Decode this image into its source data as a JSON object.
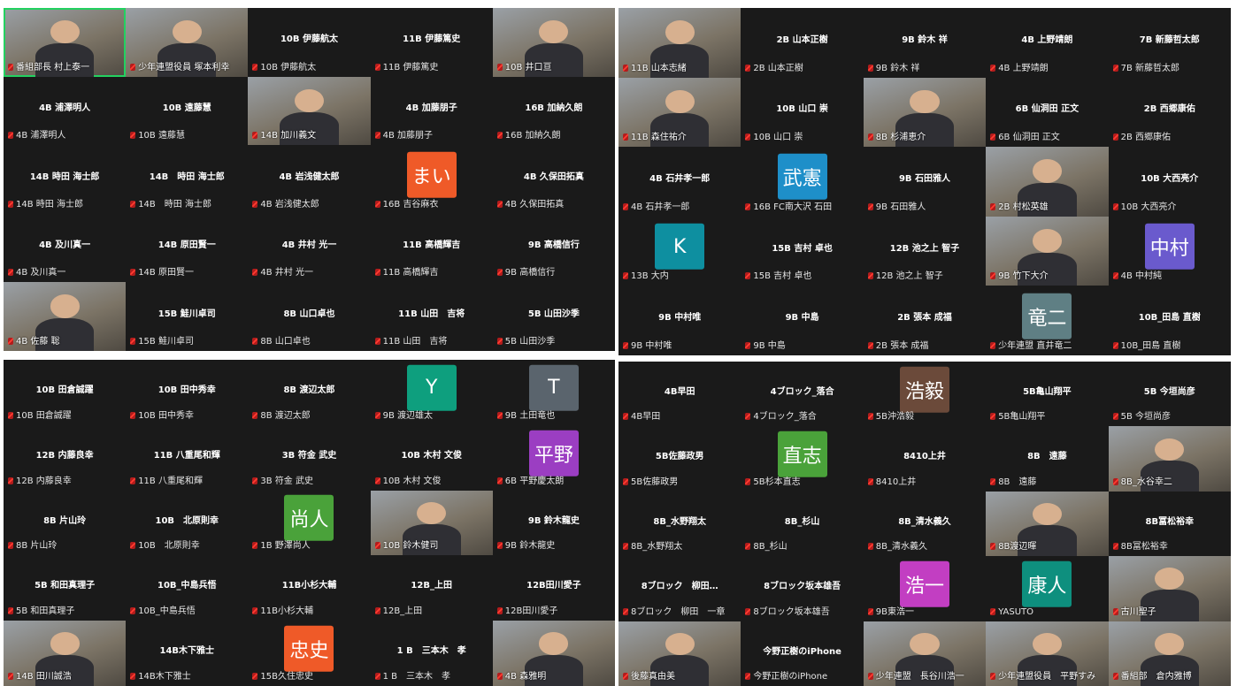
{
  "colors": {
    "bg": "#1a1a1a",
    "speaker_border": "#23d160",
    "mic_off": "#ff3b30"
  },
  "quadrants": [
    {
      "tiles": [
        {
          "type": "video",
          "label": "番組部長 村上泰一",
          "speaker": true
        },
        {
          "type": "video",
          "label": "少年連盟役員 塚本利幸"
        },
        {
          "type": "name",
          "center": "10B 伊藤航太",
          "label": "10B 伊藤航太"
        },
        {
          "type": "name",
          "center": "11B 伊藤篤史",
          "label": "11B 伊藤篤史"
        },
        {
          "type": "video",
          "label": "10B 井口亘"
        },
        {
          "type": "name",
          "center": "4B 浦澤明人",
          "label": "4B 浦澤明人"
        },
        {
          "type": "name",
          "center": "10B 遠藤慧",
          "label": "10B 遠藤慧"
        },
        {
          "type": "video",
          "label": "14B 加川義文"
        },
        {
          "type": "name",
          "center": "4B 加藤朋子",
          "label": "4B 加藤朋子"
        },
        {
          "type": "name",
          "center": "16B 加納久朗",
          "label": "16B 加納久朗"
        },
        {
          "type": "name",
          "center": "14B 時田 海士郎",
          "label": "14B 時田 海士郎"
        },
        {
          "type": "name",
          "center": "14B　時田 海士郎",
          "label": "14B　時田 海士郎"
        },
        {
          "type": "name",
          "center": "4B 岩浅健太郎",
          "label": "4B 岩浅健太郎"
        },
        {
          "type": "avatar",
          "avatar": "まい",
          "color": "#ef5a28",
          "label": "16B 吉谷麻衣"
        },
        {
          "type": "name",
          "center": "4B 久保田拓真",
          "label": "4B 久保田拓真"
        },
        {
          "type": "name",
          "center": "4B 及川真一",
          "label": "4B 及川真一"
        },
        {
          "type": "name",
          "center": "14B 原田賢一",
          "label": "14B 原田賢一"
        },
        {
          "type": "name",
          "center": "4B 井村 光一",
          "label": "4B 井村 光一"
        },
        {
          "type": "name",
          "center": "11B 高橋輝吉",
          "label": "11B 高橋輝吉"
        },
        {
          "type": "name",
          "center": "9B 高橋信行",
          "label": "9B 高橋信行"
        },
        {
          "type": "video",
          "label": "4B 佐藤 聡"
        },
        {
          "type": "name",
          "center": "15B 鮭川卓司",
          "label": "15B 鮭川卓司"
        },
        {
          "type": "name",
          "center": "8B 山口卓也",
          "label": "8B 山口卓也"
        },
        {
          "type": "name",
          "center": "11B 山田　吉将",
          "label": "11B 山田　吉将"
        },
        {
          "type": "name",
          "center": "5B 山田沙季",
          "label": "5B 山田沙季"
        }
      ]
    },
    {
      "tiles": [
        {
          "type": "video",
          "label": "11B 山本志緒"
        },
        {
          "type": "name",
          "center": "2B 山本正樹",
          "label": "2B 山本正樹"
        },
        {
          "type": "name",
          "center": "9B 鈴木 祥",
          "label": "9B 鈴木 祥"
        },
        {
          "type": "name",
          "center": "4B 上野靖朗",
          "label": "4B 上野靖朗"
        },
        {
          "type": "name",
          "center": "7B 新藤哲太郎",
          "label": "7B 新藤哲太郎"
        },
        {
          "type": "video",
          "label": "11B 森住祐介"
        },
        {
          "type": "name",
          "center": "10B 山口 崇",
          "label": "10B 山口 崇"
        },
        {
          "type": "video",
          "label": "8B 杉浦恵介"
        },
        {
          "type": "name",
          "center": "6B 仙洞田 正文",
          "label": "6B 仙洞田 正文"
        },
        {
          "type": "name",
          "center": "2B 西郷康佑",
          "label": "2B 西郷康佑"
        },
        {
          "type": "name",
          "center": "4B 石井孝一郎",
          "label": "4B 石井孝一郎"
        },
        {
          "type": "avatar",
          "avatar": "武憲",
          "color": "#1e8fc9",
          "label": "16B FC南大沢 石田"
        },
        {
          "type": "name",
          "center": "9B 石田雅人",
          "label": "9B 石田雅人"
        },
        {
          "type": "video",
          "label": "2B 村松英雄"
        },
        {
          "type": "name",
          "center": "10B 大西亮介",
          "label": "10B 大西亮介"
        },
        {
          "type": "avatar",
          "avatar": "K",
          "color": "#0e8fa0",
          "label": "13B 大内"
        },
        {
          "type": "name",
          "center": "15B 吉村 卓也",
          "label": "15B 吉村 卓也"
        },
        {
          "type": "name",
          "center": "12B 池之上 智子",
          "label": "12B 池之上 智子"
        },
        {
          "type": "video",
          "label": "9B 竹下大介"
        },
        {
          "type": "avatar",
          "avatar": "中村",
          "color": "#6a5acd",
          "label": "4B 中村純"
        },
        {
          "type": "name",
          "center": "9B 中村唯",
          "label": "9B 中村唯"
        },
        {
          "type": "name",
          "center": "9B 中島",
          "label": "9B 中島"
        },
        {
          "type": "name",
          "center": "2B 張本 成福",
          "label": "2B 張本 成福"
        },
        {
          "type": "avatar",
          "avatar": "竜二",
          "color": "#5f7f84",
          "label": "少年連盟 直井竜二"
        },
        {
          "type": "name",
          "center": "10B_田島 直樹",
          "label": "10B_田島 直樹"
        }
      ]
    },
    {
      "tiles": [
        {
          "type": "name",
          "center": "10B 田倉誠躍",
          "label": "10B 田倉誠躍"
        },
        {
          "type": "name",
          "center": "10B 田中秀幸",
          "label": "10B 田中秀幸"
        },
        {
          "type": "name",
          "center": "8B 渡辺太郎",
          "label": "8B 渡辺太郎"
        },
        {
          "type": "avatar",
          "avatar": "Y",
          "color": "#0e9f7e",
          "label": "9B 渡辺雄太"
        },
        {
          "type": "avatar",
          "avatar": "T",
          "color": "#5a646d",
          "label": "9B 土田竜也"
        },
        {
          "type": "name",
          "center": "12B 内藤良幸",
          "label": "12B 内藤良幸"
        },
        {
          "type": "name",
          "center": "11B 八重尾和輝",
          "label": "11B 八重尾和輝"
        },
        {
          "type": "name",
          "center": "3B 符金 武史",
          "label": "3B 符金 武史"
        },
        {
          "type": "name",
          "center": "10B 木村 文俊",
          "label": "10B 木村 文俊"
        },
        {
          "type": "avatar",
          "avatar": "平野",
          "color": "#9b3ec2",
          "label": "6B 平野慶太朗"
        },
        {
          "type": "name",
          "center": "8B 片山玲",
          "label": "8B 片山玲"
        },
        {
          "type": "name",
          "center": "10B　北原則幸",
          "label": "10B　北原則幸"
        },
        {
          "type": "avatar",
          "avatar": "尚人",
          "color": "#4aa23a",
          "label": "1B 野澤尚人"
        },
        {
          "type": "video",
          "label": "10B 鈴木健司"
        },
        {
          "type": "name",
          "center": "9B 鈴木龍史",
          "label": "9B 鈴木龍史"
        },
        {
          "type": "name",
          "center": "5B 和田真理子",
          "label": "5B 和田真理子"
        },
        {
          "type": "name",
          "center": "10B_中島兵悟",
          "label": "10B_中島兵悟"
        },
        {
          "type": "name",
          "center": "11B小杉大輔",
          "label": "11B小杉大輔"
        },
        {
          "type": "name",
          "center": "12B_上田",
          "label": "12B_上田"
        },
        {
          "type": "name",
          "center": "12B田川愛子",
          "label": "12B田川愛子"
        },
        {
          "type": "video",
          "label": "14B 田川誠浩"
        },
        {
          "type": "name",
          "center": "14B木下雅士",
          "label": "14B木下雅士"
        },
        {
          "type": "avatar",
          "avatar": "忠史",
          "color": "#ef5a28",
          "label": "15B久住忠史"
        },
        {
          "type": "name",
          "center": "1 B　三本木　孝",
          "label": "1 B　三本木　孝"
        },
        {
          "type": "video",
          "label": "4B 森雅明"
        }
      ]
    },
    {
      "tiles": [
        {
          "type": "name",
          "center": "4B早田",
          "label": "4B早田"
        },
        {
          "type": "name",
          "center": "4ブロック_落合",
          "label": "4ブロック_落合"
        },
        {
          "type": "avatar",
          "avatar": "浩毅",
          "color": "#6b4a3a",
          "label": "5B沖浩毅"
        },
        {
          "type": "name",
          "center": "5B亀山翔平",
          "label": "5B亀山翔平"
        },
        {
          "type": "name",
          "center": "5B 今垣尚彦",
          "label": "5B 今垣尚彦"
        },
        {
          "type": "name",
          "center": "5B佐藤政男",
          "label": "5B佐藤政男"
        },
        {
          "type": "avatar",
          "avatar": "直志",
          "color": "#4aa23a",
          "label": "5B杉本直志"
        },
        {
          "type": "name",
          "center": "8410上井",
          "label": "8410上井"
        },
        {
          "type": "name",
          "center": "8B　遠藤",
          "label": "8B　遠藤"
        },
        {
          "type": "video",
          "label": "8B_水谷幸二"
        },
        {
          "type": "name",
          "center": "8B_水野翔太",
          "label": "8B_水野翔太"
        },
        {
          "type": "name",
          "center": "8B_杉山",
          "label": "8B_杉山"
        },
        {
          "type": "name",
          "center": "8B_清水義久",
          "label": "8B_清水義久"
        },
        {
          "type": "video",
          "label": "8B渡辺暉"
        },
        {
          "type": "name",
          "center": "8B冨松裕幸",
          "label": "8B冨松裕幸"
        },
        {
          "type": "name",
          "center": "8ブロック　柳田…",
          "label": "8ブロック　柳田　一章"
        },
        {
          "type": "name",
          "center": "8ブロック坂本雄吾",
          "label": "8ブロック坂本雄吾"
        },
        {
          "type": "avatar",
          "avatar": "浩一",
          "color": "#c23ec2",
          "label": "9B東浩一"
        },
        {
          "type": "avatar",
          "avatar": "康人",
          "color": "#0e8f7e",
          "label": "YASUTO"
        },
        {
          "type": "video",
          "label": "古川聖子"
        },
        {
          "type": "video",
          "label": "後藤真由美"
        },
        {
          "type": "name",
          "center": "今野正樹のiPhone",
          "label": "今野正樹のiPhone"
        },
        {
          "type": "video",
          "label": "少年連盟　長谷川浩一"
        },
        {
          "type": "video",
          "label": "少年連盟役員　平野すみ"
        },
        {
          "type": "video",
          "label": "番組部　倉内雅博"
        }
      ]
    }
  ]
}
